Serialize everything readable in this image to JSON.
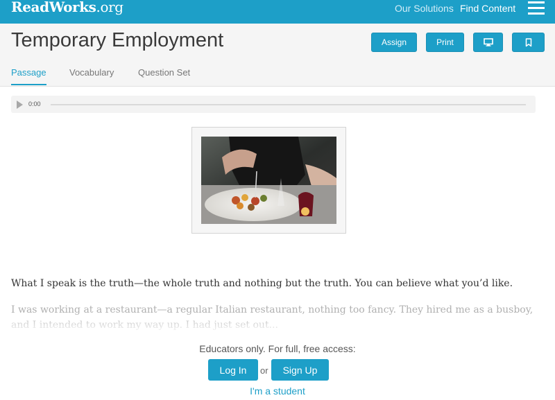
{
  "nav": {
    "logo_main": "ReadWorks",
    "logo_suffix": ".org",
    "our_solutions": "Our Solutions",
    "find_content": "Find Content",
    "menu_icon": "hamburger-menu-icon"
  },
  "header": {
    "title": "Temporary Employment",
    "buttons": {
      "assign": "Assign",
      "print": "Print",
      "present_icon": "monitor-icon",
      "bookmark_icon": "bookmark-icon"
    },
    "tabs": [
      {
        "label": "Passage",
        "active": true
      },
      {
        "label": "Vocabulary",
        "active": false
      },
      {
        "label": "Question Set",
        "active": false
      }
    ]
  },
  "audio": {
    "time": "0:00",
    "progress": 0,
    "play_icon": "play-icon"
  },
  "passage": {
    "image_alt": "person eating a plated meal at a restaurant table",
    "paragraphs": [
      "What I speak is the truth—the whole truth and nothing but the truth. You can believe what you’d like.",
      "I was working at a restaurant—a regular Italian restaurant, nothing too fancy. They hired me as a busboy, and I intended to work my way up. I had just set out..."
    ]
  },
  "access": {
    "prompt": "Educators only. For full, free access:",
    "login": "Log In",
    "or": "or",
    "signup": "Sign Up",
    "student": "I'm a student"
  },
  "colors": {
    "brand": "#1d9fc8",
    "header_bg": "#f5f5f5"
  }
}
